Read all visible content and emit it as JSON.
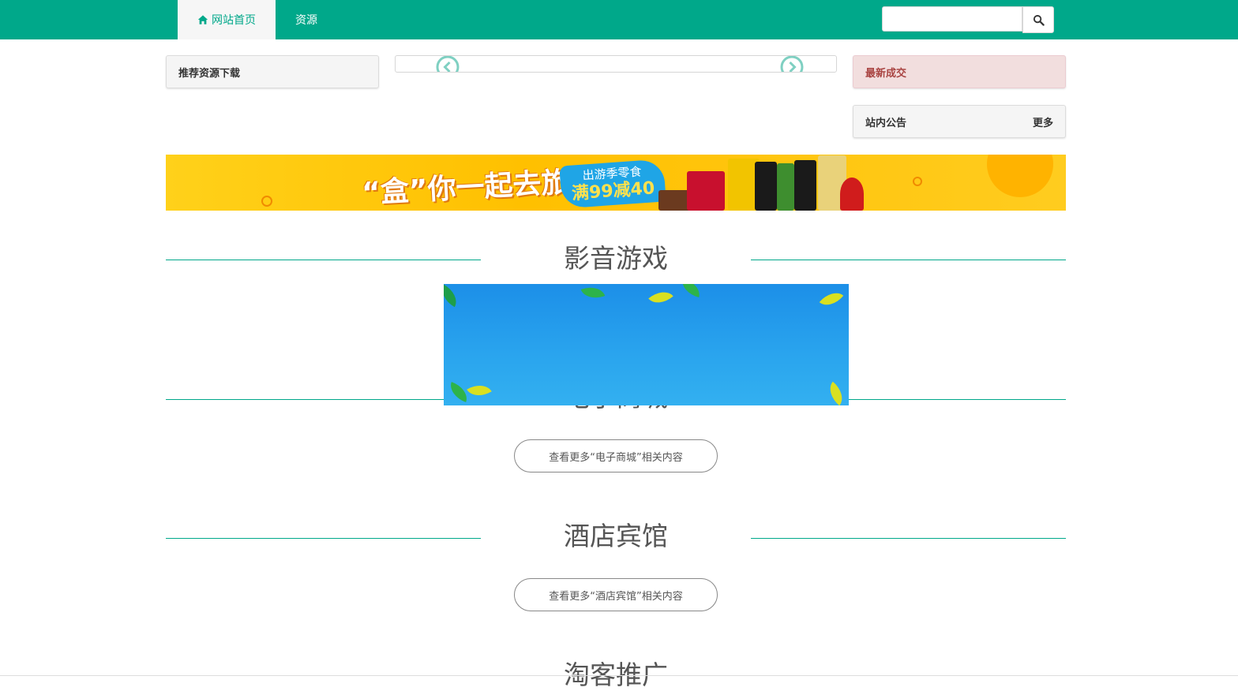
{
  "nav": {
    "home_label": "网站首页",
    "resources_label": "资源"
  },
  "search": {
    "placeholder": "",
    "value": ""
  },
  "panels": {
    "recommended_title": "推荐资源下载",
    "latest_deals_title": "最新成交",
    "notice_title": "站内公告",
    "notice_more": "更多"
  },
  "banner": {
    "slogan": "“盒”你一起去旅行",
    "badge_top": "出游季零食",
    "badge_main": "满99减40"
  },
  "sections": [
    {
      "title": "影音游戏"
    },
    {
      "title": "电子商城",
      "more_label": "查看更多“电子商城”相关内容"
    },
    {
      "title": "酒店宾馆",
      "more_label": "查看更多“酒店宾馆”相关内容"
    },
    {
      "title": "淘客推广"
    }
  ],
  "colors": {
    "brand": "#00a88a",
    "deal_panel_bg": "#f2dede",
    "deal_panel_text": "#a94442"
  },
  "icons": {
    "home": "home-icon",
    "search": "search-icon",
    "prev": "chevron-left-circle-icon",
    "next": "chevron-right-circle-icon"
  }
}
